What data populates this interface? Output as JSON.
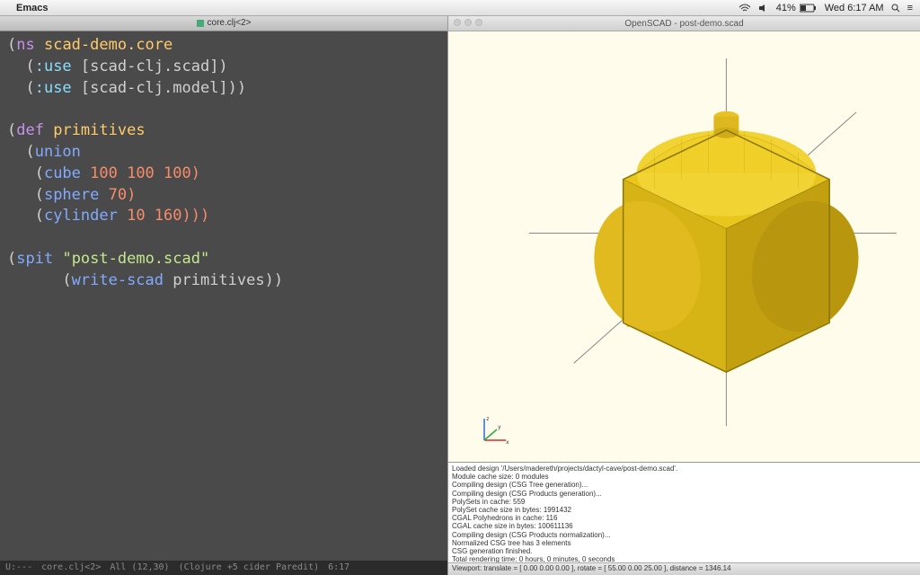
{
  "menubar": {
    "appname": "Emacs",
    "battery": "41%",
    "clock": "Wed 6:17 AM"
  },
  "emacs": {
    "tab_label": "core.clj<2>",
    "modeline": {
      "left": "U:---",
      "buffer": "core.clj<2>",
      "pos": "All (12,30)",
      "mode": "(Clojure +5 cider Paredit)",
      "time": "6:17"
    },
    "code": {
      "l1a": "(",
      "l1b": "ns",
      "l1c": " scad-demo.core",
      "l2a": "  (",
      "l2b": ":use",
      "l2c": " [scad-clj.scad])",
      "l3a": "  (",
      "l3b": ":use",
      "l3c": " [scad-clj.model]))",
      "l5a": "(",
      "l5b": "def",
      "l5c": " ",
      "l5d": "primitives",
      "l6a": "  (",
      "l6b": "union",
      "l7a": "   (",
      "l7b": "cube",
      "l7c": " 100 100 100)",
      "l8a": "   (",
      "l8b": "sphere",
      "l8c": " 70)",
      "l9a": "   (",
      "l9b": "cylinder",
      "l9c": " 10 160)))",
      "l11a": "(",
      "l11b": "spit",
      "l11c": " ",
      "l11d": "\"post-demo.scad\"",
      "l12a": "      (",
      "l12b": "write-scad",
      "l12c": " primitives))"
    }
  },
  "openscad": {
    "title": "OpenSCAD - post-demo.scad",
    "console_lines": [
      "Loaded design '/Users/madereth/projects/dactyl-cave/post-demo.scad'.",
      "Module cache size: 0 modules",
      "Compiling design (CSG Tree generation)...",
      "Compiling design (CSG Products generation)...",
      "PolySets in cache: 559",
      "PolySet cache size in bytes: 1991432",
      "CGAL Polyhedrons in cache: 116",
      "CGAL cache size in bytes: 100611136",
      "Compiling design (CSG Products normalization)...",
      "Normalized CSG tree has 3 elements",
      "CSG generation finished.",
      "Total rendering time: 0 hours, 0 minutes, 0 seconds"
    ],
    "statusbar": "Viewport: translate = [ 0.00 0.00 0.00 ], rotate = [ 55.00 0.00 25.00 ], distance = 1346.14"
  }
}
